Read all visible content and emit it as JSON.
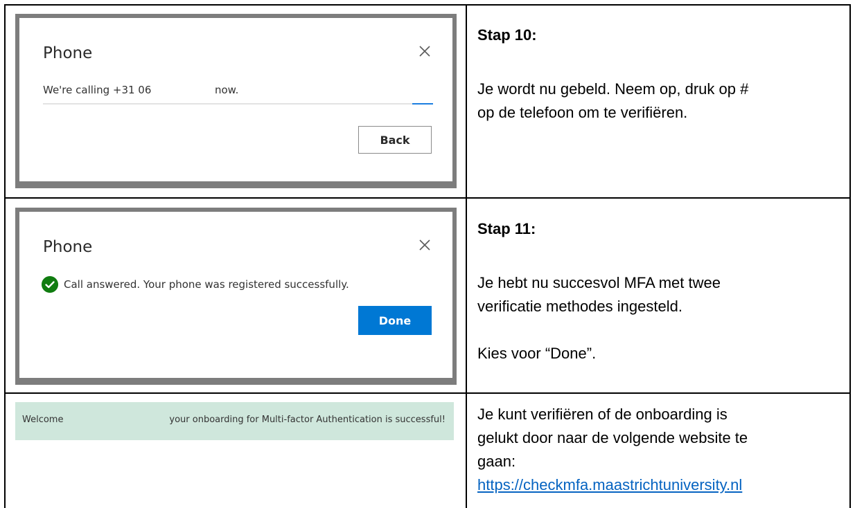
{
  "row1": {
    "dialog": {
      "title": "Phone",
      "message_prefix": "We're calling +31 06",
      "message_suffix": "now.",
      "back_label": "Back",
      "progress": 0.05,
      "close_icon": "close-icon"
    },
    "step_title": "Stap 10:",
    "step_text_1": "Je wordt nu gebeld. Neem op, druk op #",
    "step_text_2": "op de telefoon om te verifiëren."
  },
  "row2": {
    "dialog": {
      "title": "Phone",
      "message": "Call answered. Your phone was registered successfully.",
      "done_label": "Done",
      "status_icon": "check-circle-icon",
      "close_icon": "close-icon"
    },
    "step_title": "Stap 11:",
    "step_text_1": "Je hebt nu succesvol MFA met twee",
    "step_text_2": "verificatie methodes ingesteld.",
    "step_text_3": "Kies voor “Done”."
  },
  "row3": {
    "banner": {
      "welcome": "Welcome",
      "message": "your onboarding for Multi-factor Authentication is successful!"
    },
    "text_1": "Je kunt verifiëren of de onboarding is",
    "text_2": "gelukt door naar de volgende website te",
    "text_3": "gaan:",
    "link": "https://checkmfa.maastrichtuniversity.nl"
  },
  "colors": {
    "primary_button": "#0078d4",
    "success_check": "#107c10",
    "banner_bg": "#cfe7dc",
    "link": "#0563c1"
  }
}
